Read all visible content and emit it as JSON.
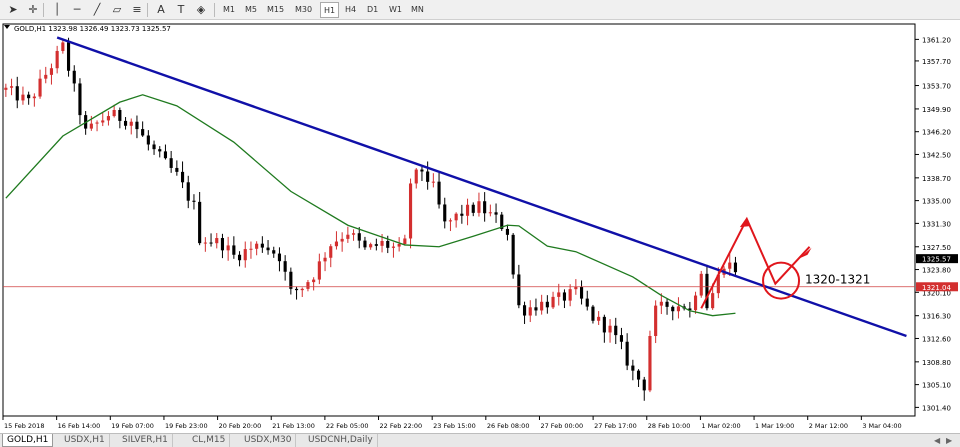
{
  "toolbar": {
    "icons": [
      {
        "name": "cursor-icon",
        "glyph": "➤"
      },
      {
        "name": "crosshair-icon",
        "glyph": "✛"
      },
      {
        "name": "vertical-line-icon",
        "glyph": "│"
      },
      {
        "name": "horizontal-line-icon",
        "glyph": "─"
      },
      {
        "name": "trendline-icon",
        "glyph": "╱"
      },
      {
        "name": "channel-icon",
        "glyph": "▱"
      },
      {
        "name": "fibonacci-icon",
        "glyph": "≡"
      },
      {
        "name": "text-icon",
        "glyph": "A"
      },
      {
        "name": "text-label-icon",
        "glyph": "T"
      },
      {
        "name": "shapes-icon",
        "glyph": "◈"
      }
    ],
    "timeframes": [
      "M1",
      "M5",
      "M15",
      "M30",
      "H1",
      "H4",
      "D1",
      "W1",
      "MN"
    ],
    "active_timeframe": "H1"
  },
  "chart_info": {
    "header": "GOLD,H1  1323.98 1326.49 1323.73 1325.57"
  },
  "annotation": {
    "label": "1320-1321"
  },
  "colors": {
    "bull": "#d32f2f",
    "bear": "#000000",
    "trendline": "#1010a8",
    "ma": "#1f7a1f",
    "hline": "#d04040",
    "annotation": "#e0161c",
    "current_price_bg": "#000000",
    "hline_price_bg": "#d32f2f"
  },
  "chart_data": {
    "type": "candlestick",
    "symbol": "GOLD,H1",
    "header_values": {
      "open": 1323.98,
      "high": 1326.49,
      "low": 1323.73,
      "close": 1325.57
    },
    "y_axis": {
      "ticks": [
        "1361.20",
        "1357.70",
        "1353.70",
        "1349.90",
        "1346.20",
        "1342.50",
        "1338.70",
        "1335.00",
        "1331.30",
        "1327.50",
        "1323.80",
        "1320.10",
        "1316.30",
        "1312.60",
        "1308.80",
        "1305.10",
        "1301.40"
      ],
      "ylim": [
        1300.0,
        1363.7
      ]
    },
    "current_price": "1325.57",
    "horizontal_line": {
      "price": 1321.0,
      "label": "1321.04"
    },
    "x_axis": {
      "labels": [
        "15 Feb 2018",
        "16 Feb 14:00",
        "19 Feb 07:00",
        "19 Feb 23:00",
        "20 Feb 20:00",
        "21 Feb 13:00",
        "22 Feb 05:00",
        "22 Feb 22:00",
        "23 Feb 15:00",
        "26 Feb 08:00",
        "27 Feb 00:00",
        "27 Feb 17:00",
        "28 Feb 10:00",
        "1 Mar 02:00",
        "1 Mar 19:00",
        "2 Mar 12:00",
        "3 Mar 04:00"
      ],
      "count": 160
    },
    "trendline": {
      "start": [
        9,
        1361.5
      ],
      "end": [
        158,
        1313.0
      ]
    },
    "moving_average": [
      [
        0,
        1335.4
      ],
      [
        10,
        1345.5
      ],
      [
        20,
        1351.0
      ],
      [
        24,
        1352.2
      ],
      [
        30,
        1350.4
      ],
      [
        40,
        1344.5
      ],
      [
        50,
        1336.5
      ],
      [
        60,
        1331.0
      ],
      [
        70,
        1327.8
      ],
      [
        76,
        1327.5
      ],
      [
        82,
        1329.2
      ],
      [
        88,
        1331.0
      ],
      [
        90,
        1330.9
      ],
      [
        95,
        1327.6
      ],
      [
        100,
        1326.7
      ],
      [
        110,
        1322.6
      ],
      [
        115,
        1319.6
      ],
      [
        120,
        1317.1
      ],
      [
        124,
        1316.3
      ],
      [
        128,
        1316.7
      ]
    ],
    "path_points": [
      [
        0,
        1353
      ],
      [
        4,
        1351
      ],
      [
        8,
        1357
      ],
      [
        10,
        1360
      ],
      [
        12,
        1353
      ],
      [
        14,
        1346
      ],
      [
        18,
        1349
      ],
      [
        22,
        1348
      ],
      [
        25,
        1344
      ],
      [
        30,
        1339
      ],
      [
        33,
        1334
      ],
      [
        34,
        1329
      ],
      [
        38,
        1328
      ],
      [
        40,
        1326
      ],
      [
        45,
        1328
      ],
      [
        48,
        1326
      ],
      [
        50,
        1320
      ],
      [
        52,
        1321
      ],
      [
        54,
        1323
      ],
      [
        57,
        1328
      ],
      [
        60,
        1330
      ],
      [
        63,
        1327
      ],
      [
        66,
        1328
      ],
      [
        69,
        1327
      ],
      [
        70,
        1328
      ],
      [
        71,
        1338
      ],
      [
        73,
        1340
      ],
      [
        75,
        1337
      ],
      [
        77,
        1331
      ],
      [
        80,
        1333
      ],
      [
        83,
        1334
      ],
      [
        86,
        1332
      ],
      [
        88,
        1330
      ],
      [
        89,
        1323
      ],
      [
        90,
        1317
      ],
      [
        93,
        1318
      ],
      [
        97,
        1319
      ],
      [
        100,
        1320
      ],
      [
        103,
        1316
      ],
      [
        106,
        1314
      ],
      [
        108,
        1311
      ],
      [
        110,
        1307
      ],
      [
        112,
        1305
      ],
      [
        114,
        1317
      ],
      [
        116,
        1318
      ],
      [
        119,
        1318
      ],
      [
        120,
        1317
      ],
      [
        122,
        1324
      ],
      [
        123,
        1318
      ],
      [
        124,
        1320
      ],
      [
        126,
        1325
      ],
      [
        128,
        1324
      ]
    ],
    "annotation_circle": {
      "x": 136,
      "price": 1322.0
    },
    "annotation_arrow": {
      "points": [
        [
          122,
          1317.5
        ],
        [
          130,
          1332.0
        ],
        [
          135,
          1321.5
        ],
        [
          141,
          1327.5
        ]
      ]
    }
  },
  "tabs": [
    "GOLD,H1",
    "USDX,H1",
    "SILVER,H1",
    "CL,M15",
    "USDX,M30",
    "USDCNH,Daily"
  ],
  "active_tab": "GOLD,H1"
}
